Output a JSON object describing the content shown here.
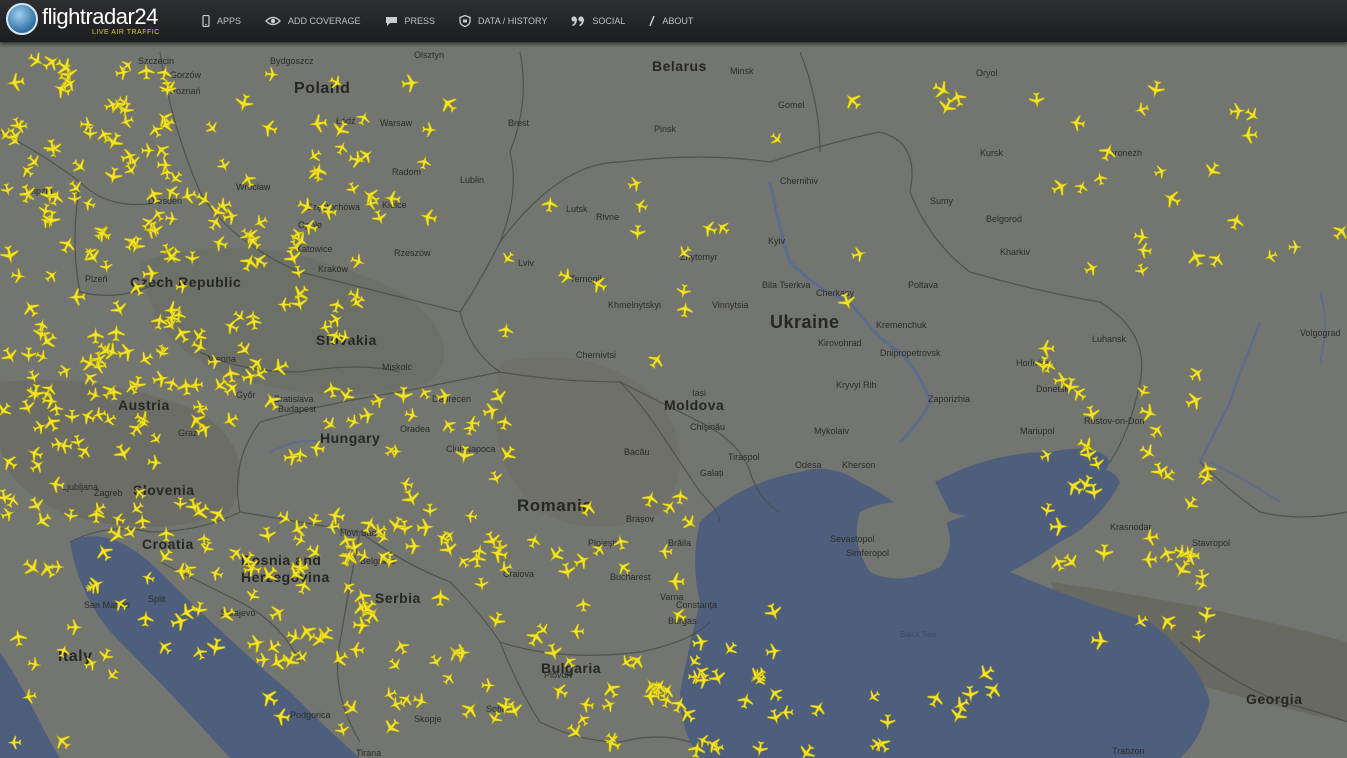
{
  "header": {
    "logo_name": "flightradar24",
    "logo_tagline": "LIVE AIR TRAFFIC",
    "nav": [
      {
        "label": "APPS",
        "icon": "phone-icon"
      },
      {
        "label": "ADD COVERAGE",
        "icon": "eye-icon"
      },
      {
        "label": "PRESS",
        "icon": "chat-bubble-icon"
      },
      {
        "label": "DATA / HISTORY",
        "icon": "shield-icon"
      },
      {
        "label": "SOCIAL",
        "icon": "quote-icon"
      },
      {
        "label": "ABOUT",
        "icon": "slash-icon"
      }
    ]
  },
  "map": {
    "countries": [
      "Poland",
      "Belarus",
      "Ukraine",
      "Slovakia",
      "Czech Republic",
      "Austria",
      "Hungary",
      "Slovenia",
      "Croatia",
      "Bosnia and Herzegovina",
      "Serbia",
      "Romania",
      "Moldova",
      "Bulgaria",
      "Italy",
      "Georgia"
    ],
    "cities": [
      "Szczecin",
      "Gorzów",
      "Poznań",
      "Bydgoszcz",
      "Olsztyn",
      "Wrocław",
      "Łódź",
      "Warsaw",
      "Radom",
      "Lublin",
      "Kielce",
      "Częstochowa",
      "Opole",
      "Katowice",
      "Rzeszów",
      "Kraków",
      "Leipzig",
      "Dresden",
      "Plzeň",
      "Vienna",
      "Graz",
      "Bratislava",
      "Budapest",
      "Győr",
      "Miskolc",
      "Debrecen",
      "Oradea",
      "Cluj-Napoca",
      "Iași",
      "Chişinău",
      "Bacău",
      "Brașov",
      "Ploiești",
      "Bucharest",
      "Craiova",
      "Constanța",
      "Brăila",
      "Galați",
      "Tiraspol",
      "Odesa",
      "Mykolaiv",
      "Kherson",
      "Chernivtsi",
      "Ternopil",
      "Lviv",
      "Lutsk",
      "Rivne",
      "Zhytomyr",
      "Kyiv",
      "Bila Tserkva",
      "Vinnytsia",
      "Khmelnytskyi",
      "Cherkasy",
      "Poltava",
      "Kremenchuk",
      "Kirovohrad",
      "Kryvyi Rih",
      "Dnipropetrovsk",
      "Zaporizhia",
      "Mariupol",
      "Donetsk",
      "Horlivka",
      "Luhansk",
      "Kharkiv",
      "Sumy",
      "Chernihiv",
      "Gomel",
      "Pinsk",
      "Brest",
      "Minsk",
      "Belgorod",
      "Kursk",
      "Oryol",
      "Voronezh",
      "Rostov-on-Don",
      "Volgograd",
      "Krasnodar",
      "Stavropol",
      "Sevastopol",
      "Simferopol",
      "Sarajevo",
      "Zagreb",
      "Ljubljana",
      "Split",
      "Belgrade",
      "Novi Sad",
      "Sofia",
      "Varna",
      "Burgas",
      "Plovdiv",
      "Skopje",
      "Tirana",
      "Podgorica",
      "San Marino",
      "Trabzon"
    ],
    "sea_label": "Black Sea"
  }
}
